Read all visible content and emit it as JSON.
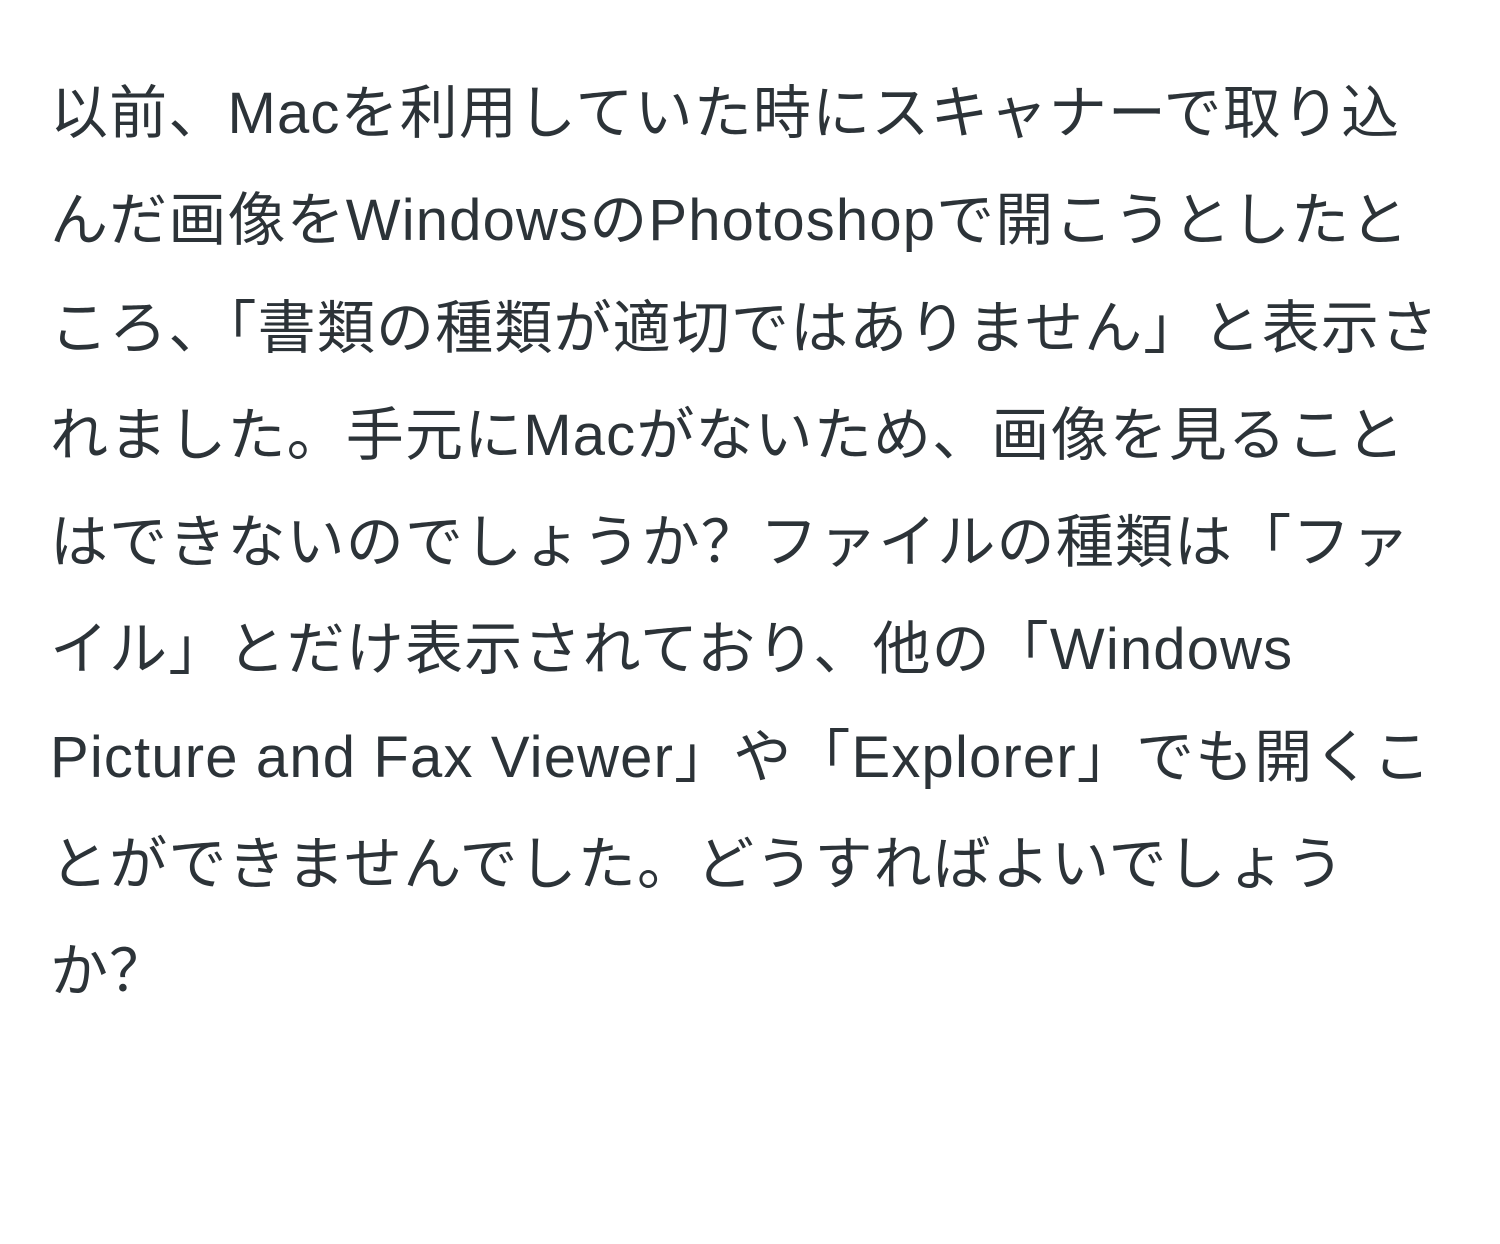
{
  "document": {
    "body_text": "以前、Macを利用していた時にスキャナーで取り込んだ画像をWindowsのPhotoshopで開こうとしたところ、「書類の種類が適切ではありません」と表示されました。手元にMacがないため、画像を見ることはできないのでしょうか？ファイルの種類は「ファイル」とだけ表示されており、他の「Windows Picture and Fax Viewer」や「Explorer」でも開くことができませんでした。どうすればよいでしょうか？"
  }
}
